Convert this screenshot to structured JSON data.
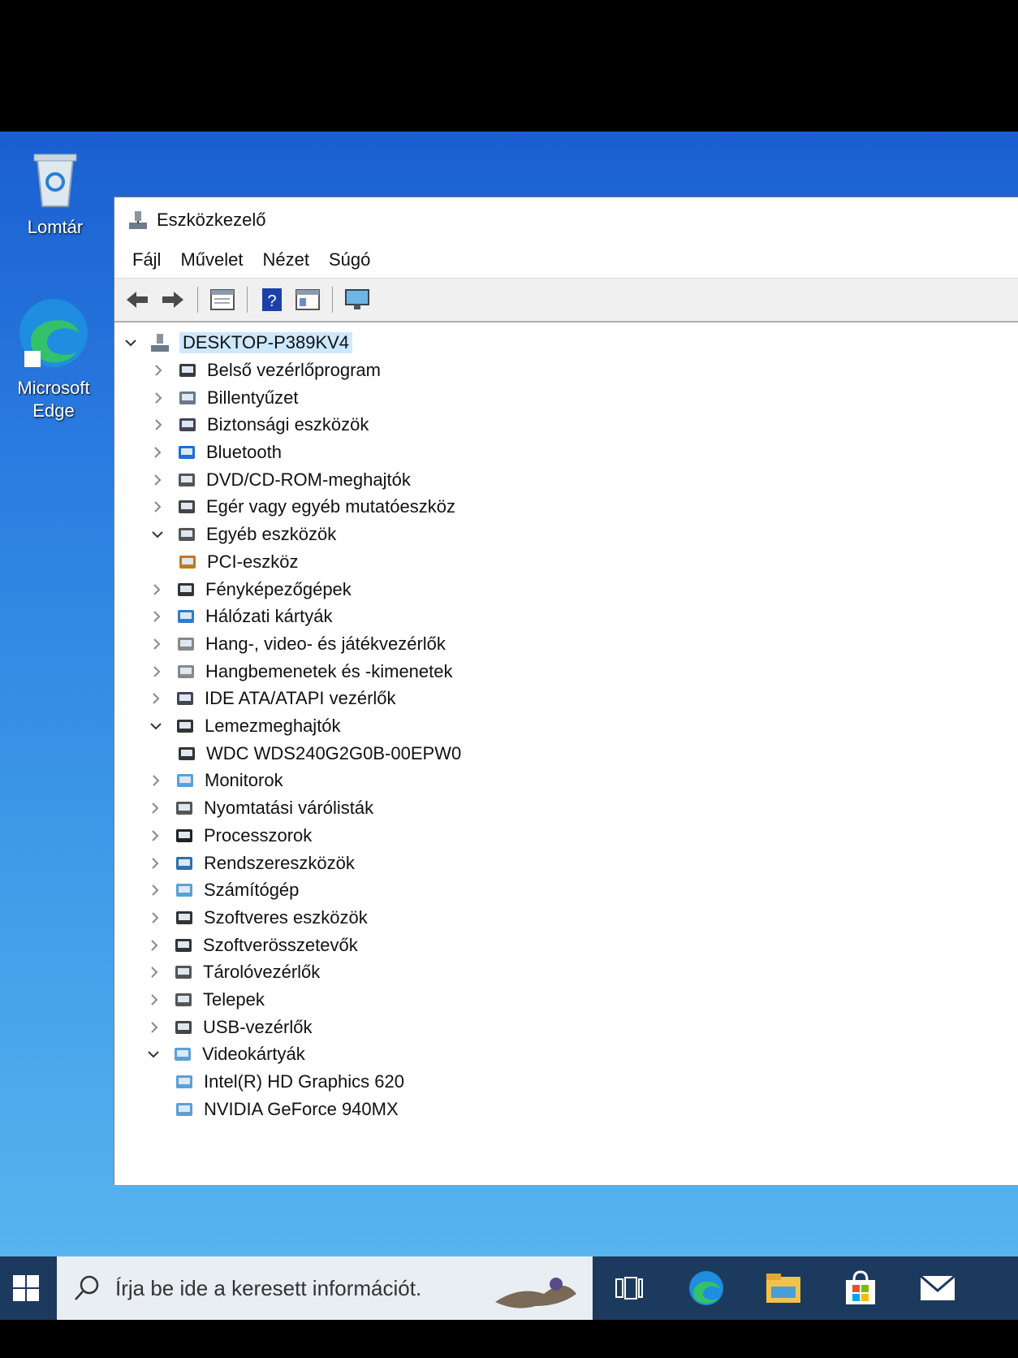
{
  "desktop": {
    "icons": [
      {
        "label": "Lomtár"
      },
      {
        "label": "Microsoft Edge"
      }
    ]
  },
  "window": {
    "title": "Eszközkezelő",
    "menu": [
      "Fájl",
      "Művelet",
      "Nézet",
      "Súgó"
    ],
    "toolbar": [
      "back-icon",
      "forward-icon",
      "properties-icon",
      "help-icon",
      "view-icon",
      "monitor-icon"
    ]
  },
  "tree": {
    "root": "DESKTOP-P389KV4",
    "items": [
      {
        "label": "Belső vezérlőprogram",
        "expanded": false
      },
      {
        "label": "Billentyűzet",
        "expanded": false
      },
      {
        "label": "Biztonsági eszközök",
        "expanded": false
      },
      {
        "label": "Bluetooth",
        "expanded": false
      },
      {
        "label": "DVD/CD-ROM-meghajtók",
        "expanded": false
      },
      {
        "label": "Egér vagy egyéb mutatóeszköz",
        "expanded": false
      },
      {
        "label": "Egyéb eszközök",
        "expanded": true
      },
      {
        "label": "PCI-eszköz",
        "child": true
      },
      {
        "label": "Fényképezőgépek",
        "expanded": false
      },
      {
        "label": "Hálózati kártyák",
        "expanded": false
      },
      {
        "label": "Hang-, video- és játékvezérlők",
        "expanded": false
      },
      {
        "label": "Hangbemenetek és -kimenetek",
        "expanded": false
      },
      {
        "label": "IDE ATA/ATAPI vezérlők",
        "expanded": false
      },
      {
        "label": "Lemezmeghajtók",
        "expanded": true
      },
      {
        "label": "WDC WDS240G2G0B-00EPW0",
        "child": true
      },
      {
        "label": "Monitorok",
        "expanded": false
      },
      {
        "label": "Nyomtatási várólisták",
        "expanded": false
      },
      {
        "label": "Processzorok",
        "expanded": false
      },
      {
        "label": "Rendszereszközök",
        "expanded": false
      },
      {
        "label": "Számítógép",
        "expanded": false
      },
      {
        "label": "Szoftveres eszközök",
        "expanded": false
      },
      {
        "label": "Szoftverösszetevők",
        "expanded": false
      },
      {
        "label": "Tárolóvezérlők",
        "expanded": false
      },
      {
        "label": "Telepek",
        "expanded": false
      },
      {
        "label": "USB-vezérlők",
        "expanded": false
      },
      {
        "label": "Videokártyák",
        "expanded": true
      },
      {
        "label": "Intel(R) HD Graphics 620",
        "child": true
      },
      {
        "label": "NVIDIA GeForce 940MX",
        "child": true
      }
    ]
  },
  "taskbar": {
    "search_placeholder": "Írja be ide a keresett információt.",
    "apps": [
      "task-view-icon",
      "edge-icon",
      "file-explorer-icon",
      "store-icon",
      "mail-icon"
    ]
  }
}
